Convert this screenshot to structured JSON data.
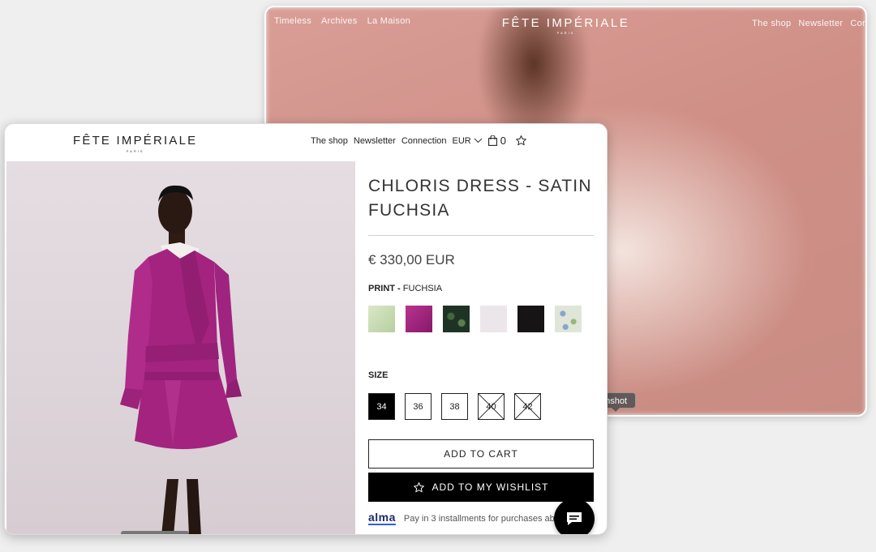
{
  "back_window": {
    "nav_left": [
      "Timeless",
      "Archives",
      "La Maison"
    ],
    "brand": "FÊTE IMPÉRIALE",
    "brand_city": "PARIS",
    "nav_right": [
      "The shop",
      "Newsletter",
      "Cor"
    ],
    "tooltip": "enshot"
  },
  "front_window": {
    "brand": "FÊTE IMPÉRIALE",
    "brand_city": "PARIS",
    "nav": {
      "shop": "The shop",
      "newsletter": "Newsletter",
      "connection": "Connection",
      "currency": "EUR",
      "cart_count": "0"
    },
    "product": {
      "title": "CHLORIS DRESS - SATIN FUCHSIA",
      "price": "€ 330,00 EUR",
      "print_label": "PRINT -",
      "print_value": "FUCHSIA",
      "swatches": [
        {
          "name": "mint",
          "color": "#c9dcb8"
        },
        {
          "name": "fuchsia",
          "color": "#a0267e"
        },
        {
          "name": "dark-floral",
          "color": "#1f3325"
        },
        {
          "name": "white",
          "color": "#ece6ea"
        },
        {
          "name": "black",
          "color": "#161414"
        },
        {
          "name": "blue-floral",
          "color": "#dfe6d8"
        }
      ],
      "size_label": "SIZE",
      "sizes": [
        {
          "label": "34",
          "state": "selected"
        },
        {
          "label": "36",
          "state": "available"
        },
        {
          "label": "38",
          "state": "available"
        },
        {
          "label": "40",
          "state": "out"
        },
        {
          "label": "42",
          "state": "out"
        }
      ],
      "add_to_cart": "ADD TO CART",
      "add_to_wishlist": "ADD TO MY WISHLIST",
      "alma_logo": "alma",
      "alma_text": "Pay in 3 installments for purchases ab"
    },
    "colors": {
      "dress": "#a3237f",
      "background": "#e1d9dd"
    }
  }
}
